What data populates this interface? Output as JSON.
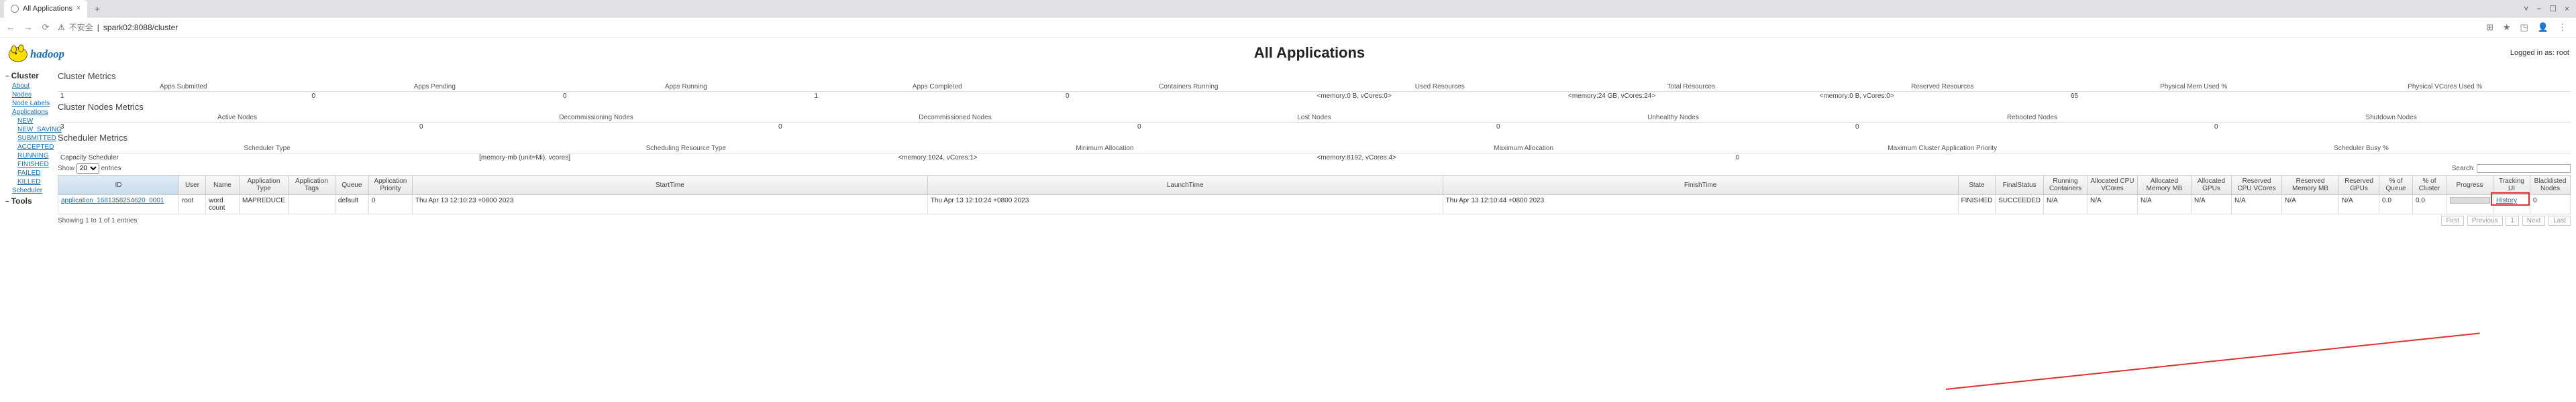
{
  "browser": {
    "tab_title": "All Applications",
    "new_tab": "+",
    "close": "×",
    "url_insecure": "不安全",
    "url": "spark02:8088/cluster",
    "min": "—",
    "max": "☐",
    "x": "×",
    "more": "⋮",
    "dash": "−",
    "back": "←",
    "fwd": "→",
    "reload": "⟳",
    "ext1": "⊞",
    "ext2": "★",
    "ext3": "◳",
    "ext4": "👤"
  },
  "header": {
    "title": "All Applications",
    "login": "Logged in as: root"
  },
  "sidebar": {
    "cluster": "Cluster",
    "about": "About",
    "nodes": "Nodes",
    "node_labels": "Node Labels",
    "applications": "Applications",
    "states": [
      "NEW",
      "NEW_SAVING",
      "SUBMITTED",
      "ACCEPTED",
      "RUNNING",
      "FINISHED",
      "FAILED",
      "KILLED"
    ],
    "scheduler": "Scheduler",
    "tools": "Tools"
  },
  "cluster_metrics": {
    "title": "Cluster Metrics",
    "headers": [
      "Apps Submitted",
      "Apps Pending",
      "Apps Running",
      "Apps Completed",
      "Containers Running",
      "Used Resources",
      "Total Resources",
      "Reserved Resources",
      "Physical Mem Used %",
      "Physical VCores Used %"
    ],
    "values": [
      "1",
      "0",
      "0",
      "1",
      "0",
      "<memory:0 B, vCores:0>",
      "<memory:24 GB, vCores:24>",
      "<memory:0 B, vCores:0>",
      "65",
      ""
    ]
  },
  "nodes_metrics": {
    "title": "Cluster Nodes Metrics",
    "headers": [
      "Active Nodes",
      "Decommissioning Nodes",
      "Decommissioned Nodes",
      "Lost Nodes",
      "Unhealthy Nodes",
      "Rebooted Nodes",
      "Shutdown Nodes"
    ],
    "values": [
      "3",
      "0",
      "0",
      "0",
      "0",
      "0",
      "0"
    ]
  },
  "sched_metrics": {
    "title": "Scheduler Metrics",
    "headers": [
      "Scheduler Type",
      "Scheduling Resource Type",
      "Minimum Allocation",
      "Maximum Allocation",
      "Maximum Cluster Application Priority",
      "Scheduler Busy %"
    ],
    "type": "Capacity Scheduler",
    "res_type": "[memory-mb (unit=Mi), vcores]",
    "min_alloc": "<memory:1024, vCores:1>",
    "max_alloc": "<memory:8192, vCores:4>",
    "max_prio": "0"
  },
  "datatable": {
    "show_label": "Show",
    "entries_label": "entries",
    "page_size": "20",
    "search_label": "Search:",
    "headers": [
      "ID",
      "User",
      "Name",
      "Application Type",
      "Application Tags",
      "Queue",
      "Application Priority",
      "StartTime",
      "LaunchTime",
      "FinishTime",
      "State",
      "FinalStatus",
      "Running Containers",
      "Allocated CPU VCores",
      "Allocated Memory MB",
      "Allocated GPUs",
      "Reserved CPU VCores",
      "Reserved Memory MB",
      "Reserved GPUs",
      "% of Queue",
      "% of Cluster",
      "Progress",
      "Tracking UI",
      "Blacklisted Nodes"
    ],
    "row": {
      "id": "application_1681358254620_0001",
      "user": "root",
      "name": "word count",
      "type": "MAPREDUCE",
      "tags": "",
      "queue": "default",
      "priority": "0",
      "start": "Thu Apr 13 12:10:23 +0800 2023",
      "launch": "Thu Apr 13 12:10:24 +0800 2023",
      "finish": "Thu Apr 13 12:10:44 +0800 2023",
      "state": "FINISHED",
      "final": "SUCCEEDED",
      "running_c": "N/A",
      "cpu_v": "N/A",
      "mem_mb": "N/A",
      "gpus": "N/A",
      "res_cpu": "N/A",
      "res_mem": "N/A",
      "res_gpu": "N/A",
      "pct_q": "0.0",
      "pct_c": "0.0",
      "tracking": "History",
      "blacklisted": "0"
    },
    "info": "Showing 1 to 1 of 1 entries",
    "pager": {
      "first": "First",
      "prev": "Previous",
      "p1": "1",
      "next": "Next",
      "last": "Last"
    }
  }
}
